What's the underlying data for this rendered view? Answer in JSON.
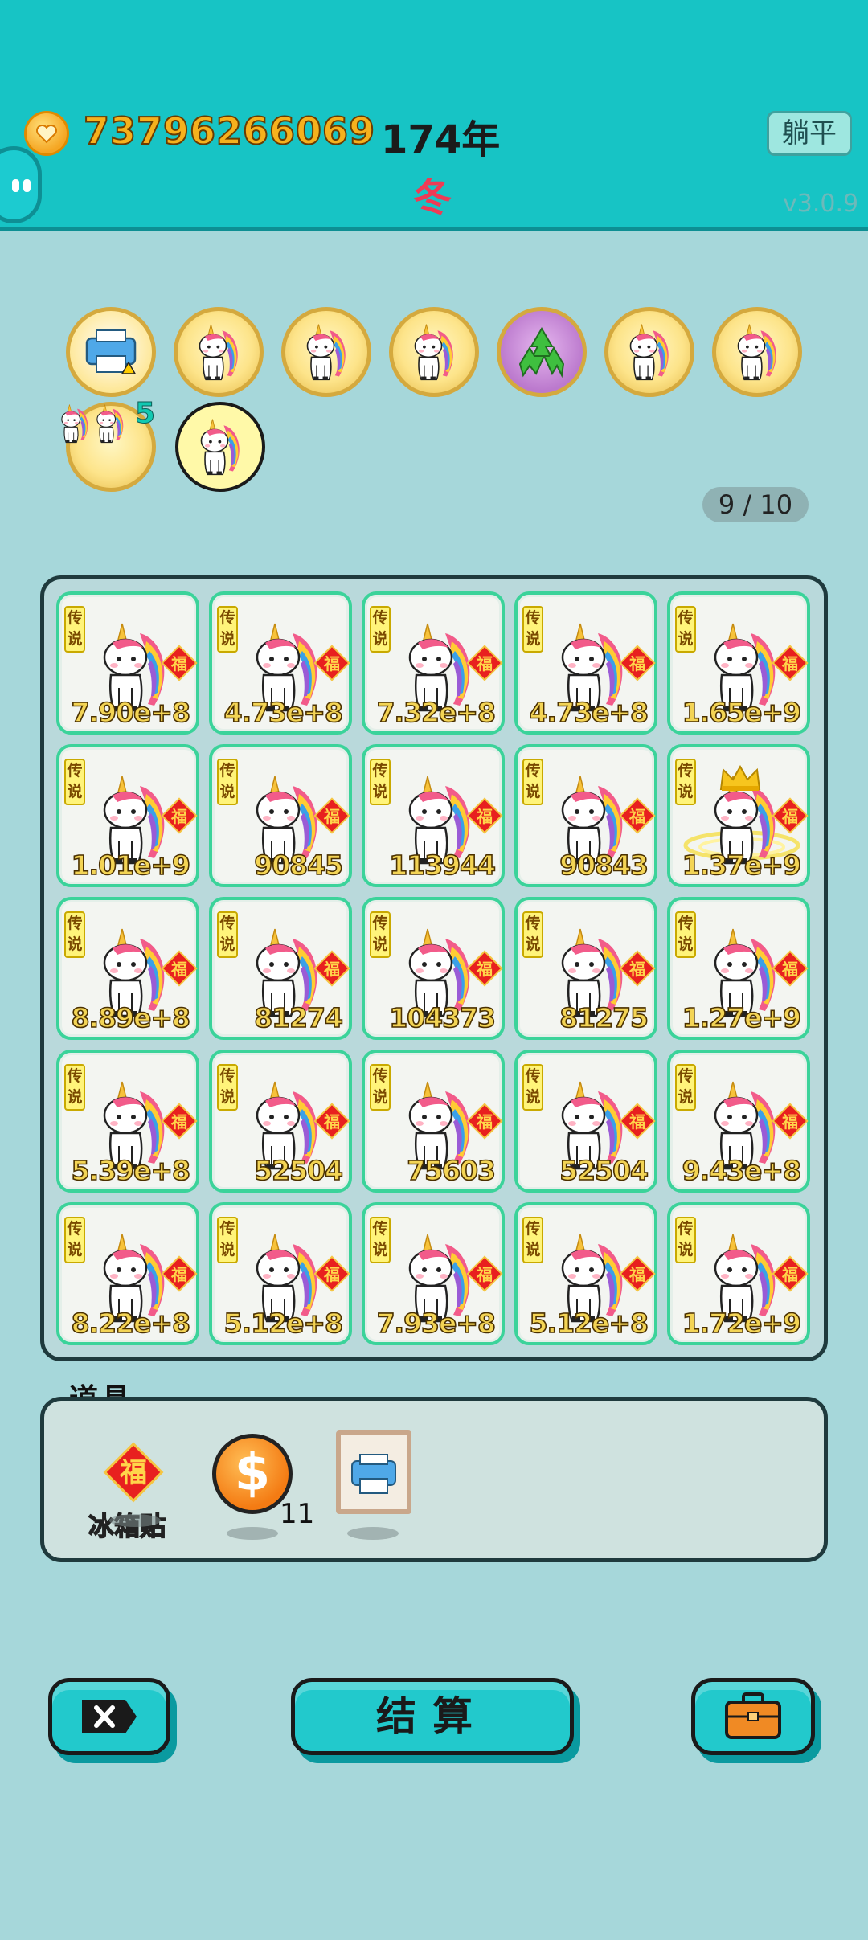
{
  "header": {
    "coins": "73796266069",
    "year": "174年",
    "season": "冬",
    "lie_flat_button": "躺平",
    "version": "v3.0.9"
  },
  "badges": {
    "row1": [
      "printer",
      "unicorn",
      "unicorn",
      "unicorn",
      "recycle",
      "unicorn",
      "unicorn"
    ],
    "row2": [
      "twin-unicorn",
      "unicorn-selected"
    ],
    "twin_count": "5",
    "progress": "9 / 10"
  },
  "board": {
    "tag": "传说",
    "cells": [
      [
        "7.90e+8",
        "4.73e+8",
        "7.32e+8",
        "4.73e+8",
        "1.65e+9"
      ],
      [
        "1.01e+9",
        "90845",
        "113944",
        "90843",
        "1.37e+9"
      ],
      [
        "8.89e+8",
        "81274",
        "104373",
        "81275",
        "1.27e+9"
      ],
      [
        "5.39e+8",
        "52504",
        "75603",
        "52504",
        "9.43e+8"
      ],
      [
        "8.22e+8",
        "5.12e+8",
        "7.93e+8",
        "5.12e+8",
        "1.72e+9"
      ]
    ],
    "crowned_cell": "row2-col5"
  },
  "items": {
    "title": "道具",
    "fu_char": "福",
    "fridge_sticker_label": "冰箱贴",
    "coin_symbol": "$",
    "coin_count": "11"
  },
  "buttons": {
    "settle": "结算"
  },
  "colors": {
    "header_bg": "#17c4c5",
    "page_bg": "#a6d7da",
    "cell_border": "#3bd39a",
    "value_text": "#f3d455",
    "season_text": "#ef3b55"
  }
}
